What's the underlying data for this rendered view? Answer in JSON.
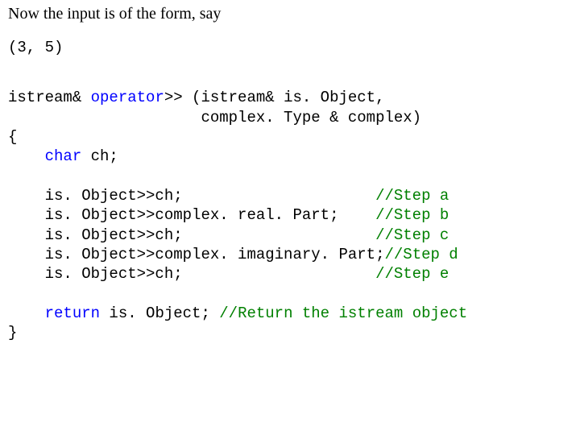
{
  "intro": "Now the input is of the form, say",
  "example_input": "(3, 5)",
  "code": {
    "l1a": "istream& ",
    "l1b": "operator",
    "l1c": ">> (istream& is. Object,",
    "l2": "                     complex. Type & complex)",
    "l3": "{",
    "l4a": "    ",
    "l4b": "char",
    "l4c": " ch;",
    "blank": "",
    "s1a": "    is. Object>>ch;                     ",
    "s1c": "//Step a",
    "s2a": "    is. Object>>complex. real. Part;    ",
    "s2c": "//Step b",
    "s3a": "    is. Object>>ch;                     ",
    "s3c": "//Step c",
    "s4a": "    is. Object>>complex. imaginary. Part;",
    "s4c": "//Step d",
    "s5a": "    is. Object>>ch;                     ",
    "s5c": "//Step e",
    "r1a": "    ",
    "r1b": "return",
    "r1c": " is. Object; ",
    "r1d": "//Return the istream object",
    "l_end": "}"
  }
}
